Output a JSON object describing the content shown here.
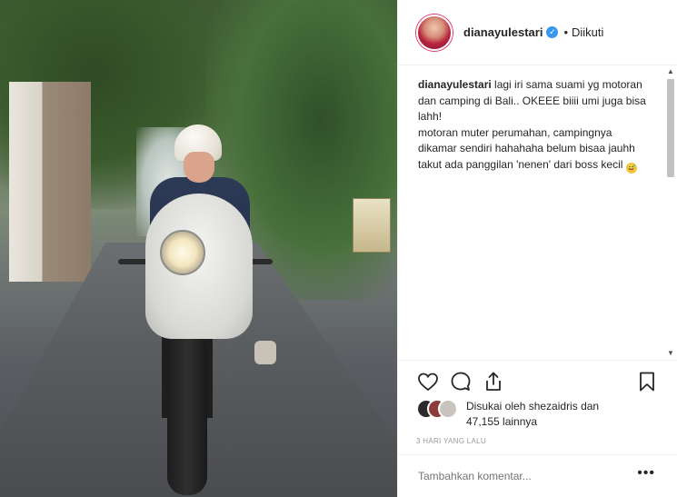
{
  "post": {
    "username": "dianayulestari",
    "follow_status": "Diikuti",
    "separator": "•",
    "verified_icon": "verified-badge-icon",
    "caption_user": "dianayulestari",
    "caption_text": " lagi iri sama suami yg motoran dan camping di Bali.. OKEEE biiii umi juga bisa lahh!\nmotoran muter perumahan, campingnya dikamar sendiri hahahaha belum bisaa jauhh takut ada panggilan 'nenen' dari boss kecil ",
    "caption_emoji": "😅"
  },
  "actions": {
    "like_icon": "heart-icon",
    "comment_icon": "comment-icon",
    "share_icon": "share-icon",
    "save_icon": "bookmark-icon"
  },
  "likes": {
    "prefix": "Disukai oleh ",
    "liker": "shezaidris",
    "middle": " dan",
    "count": "47,155",
    "suffix": " lainnya"
  },
  "timestamp": "3 HARI YANG LALU",
  "comment": {
    "placeholder": "Tambahkan komentar...",
    "more_label": "•••"
  },
  "colors": {
    "verified": "#3897f0",
    "text": "#262626",
    "muted": "#999999",
    "border": "#efefef"
  }
}
